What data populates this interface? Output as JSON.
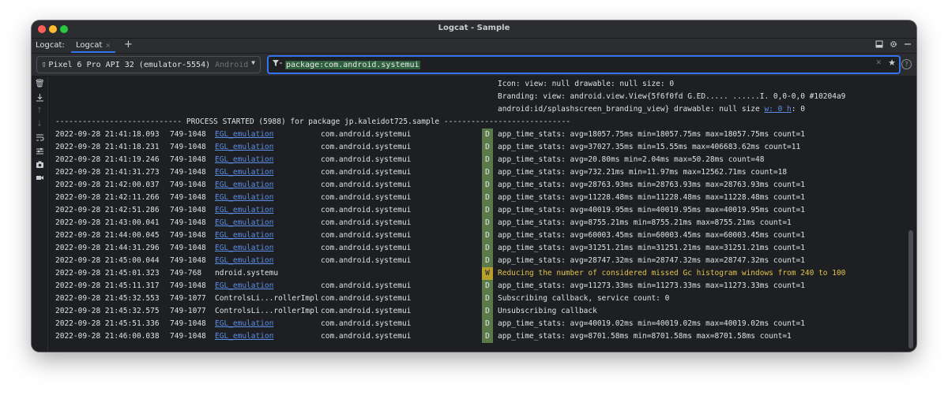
{
  "window": {
    "title": "Logcat - Sample"
  },
  "toolwindow": {
    "label": "Logcat:",
    "tab_label": "Logcat",
    "tab_close": "×",
    "add": "+"
  },
  "device": {
    "name": "Pixel 6 Pro API 32 (emulator-5554)",
    "platform": "Android"
  },
  "filter": {
    "query": "package:com.android.systemui"
  },
  "continuation_lines": [
    {
      "text": "Icon: view: null drawable: null size: 0"
    },
    {
      "text": "Branding: view: android.view.View{5f6f0fd G.ED..... ......I. 0,0-0,0 #10204a9"
    },
    {
      "text": " android:id/splashscreen_branding_view} drawable: null size ",
      "link": "w: 0 h",
      "tail": ": 0"
    }
  ],
  "process_line": "---------------------------- PROCESS STARTED (5988) for package jp.kaleidot725.sample ----------------------------",
  "rows": [
    {
      "time": "2022-09-28 21:41:18.093",
      "pid": "749-1048",
      "tag": "EGL_emulation",
      "pkg": "com.android.systemui",
      "level": "D",
      "msg": "app_time_stats: avg=18057.75ms min=18057.75ms max=18057.75ms count=1"
    },
    {
      "time": "2022-09-28 21:41:18.231",
      "pid": "749-1048",
      "tag": "EGL_emulation",
      "pkg": "com.android.systemui",
      "level": "D",
      "msg": "app_time_stats: avg=37027.35ms min=15.55ms max=406683.62ms count=11"
    },
    {
      "time": "2022-09-28 21:41:19.246",
      "pid": "749-1048",
      "tag": "EGL_emulation",
      "pkg": "com.android.systemui",
      "level": "D",
      "msg": "app_time_stats: avg=20.80ms min=2.04ms max=50.28ms count=48"
    },
    {
      "time": "2022-09-28 21:41:31.273",
      "pid": "749-1048",
      "tag": "EGL_emulation",
      "pkg": "com.android.systemui",
      "level": "D",
      "msg": "app_time_stats: avg=732.21ms min=11.97ms max=12562.71ms count=18"
    },
    {
      "time": "2022-09-28 21:42:00.037",
      "pid": "749-1048",
      "tag": "EGL_emulation",
      "pkg": "com.android.systemui",
      "level": "D",
      "msg": "app_time_stats: avg=28763.93ms min=28763.93ms max=28763.93ms count=1"
    },
    {
      "time": "2022-09-28 21:42:11.266",
      "pid": "749-1048",
      "tag": "EGL_emulation",
      "pkg": "com.android.systemui",
      "level": "D",
      "msg": "app_time_stats: avg=11228.48ms min=11228.48ms max=11228.48ms count=1"
    },
    {
      "time": "2022-09-28 21:42:51.286",
      "pid": "749-1048",
      "tag": "EGL_emulation",
      "pkg": "com.android.systemui",
      "level": "D",
      "msg": "app_time_stats: avg=40019.95ms min=40019.95ms max=40019.95ms count=1"
    },
    {
      "time": "2022-09-28 21:43:00.041",
      "pid": "749-1048",
      "tag": "EGL_emulation",
      "pkg": "com.android.systemui",
      "level": "D",
      "msg": "app_time_stats: avg=8755.21ms min=8755.21ms max=8755.21ms count=1"
    },
    {
      "time": "2022-09-28 21:44:00.045",
      "pid": "749-1048",
      "tag": "EGL_emulation",
      "pkg": "com.android.systemui",
      "level": "D",
      "msg": "app_time_stats: avg=60003.45ms min=60003.45ms max=60003.45ms count=1"
    },
    {
      "time": "2022-09-28 21:44:31.296",
      "pid": "749-1048",
      "tag": "EGL_emulation",
      "pkg": "com.android.systemui",
      "level": "D",
      "msg": "app_time_stats: avg=31251.21ms min=31251.21ms max=31251.21ms count=1"
    },
    {
      "time": "2022-09-28 21:45:00.044",
      "pid": "749-1048",
      "tag": "EGL_emulation",
      "pkg": "com.android.systemui",
      "level": "D",
      "msg": "app_time_stats: avg=28747.32ms min=28747.32ms max=28747.32ms count=1"
    },
    {
      "time": "2022-09-28 21:45:01.323",
      "pid": "749-768",
      "tag": "ndroid.systemu",
      "pkg": "",
      "level": "W",
      "msg": "Reducing the number of considered missed Gc histogram windows from 240 to 100"
    },
    {
      "time": "2022-09-28 21:45:11.317",
      "pid": "749-1048",
      "tag": "EGL_emulation",
      "pkg": "com.android.systemui",
      "level": "D",
      "msg": "app_time_stats: avg=11273.33ms min=11273.33ms max=11273.33ms count=1"
    },
    {
      "time": "2022-09-28 21:45:32.553",
      "pid": "749-1077",
      "tag": "ControlsLi...rollerImpl",
      "pkg": "com.android.systemui",
      "level": "D",
      "msg": "Subscribing callback, service count: 0"
    },
    {
      "time": "2022-09-28 21:45:32.575",
      "pid": "749-1077",
      "tag": "ControlsLi...rollerImpl",
      "pkg": "com.android.systemui",
      "level": "D",
      "msg": "Unsubscribing callback"
    },
    {
      "time": "2022-09-28 21:45:51.336",
      "pid": "749-1048",
      "tag": "EGL_emulation",
      "pkg": "com.android.systemui",
      "level": "D",
      "msg": "app_time_stats: avg=40019.02ms min=40019.02ms max=40019.02ms count=1"
    },
    {
      "time": "2022-09-28 21:46:00.038",
      "pid": "749-1048",
      "tag": "EGL_emulation",
      "pkg": "com.android.systemui",
      "level": "D",
      "msg": "app_time_stats: avg=8701.58ms min=8701.58ms max=8701.58ms count=1"
    }
  ],
  "icons": {
    "sidebar": [
      "trash-icon",
      "scroll-to-end-icon",
      "up-arrow-icon",
      "down-arrow-icon",
      "soft-wrap-icon",
      "filter-settings-icon",
      "camera-icon",
      "video-record-icon"
    ],
    "header": [
      "layout-icon",
      "gear-icon",
      "minimize-icon"
    ]
  },
  "colors": {
    "accent": "#3574f0",
    "tag_link": "#5c8fe6",
    "level_debug": "#5a7a4a",
    "level_warn": "#b8a02e",
    "warn_text": "#e0c24c"
  }
}
